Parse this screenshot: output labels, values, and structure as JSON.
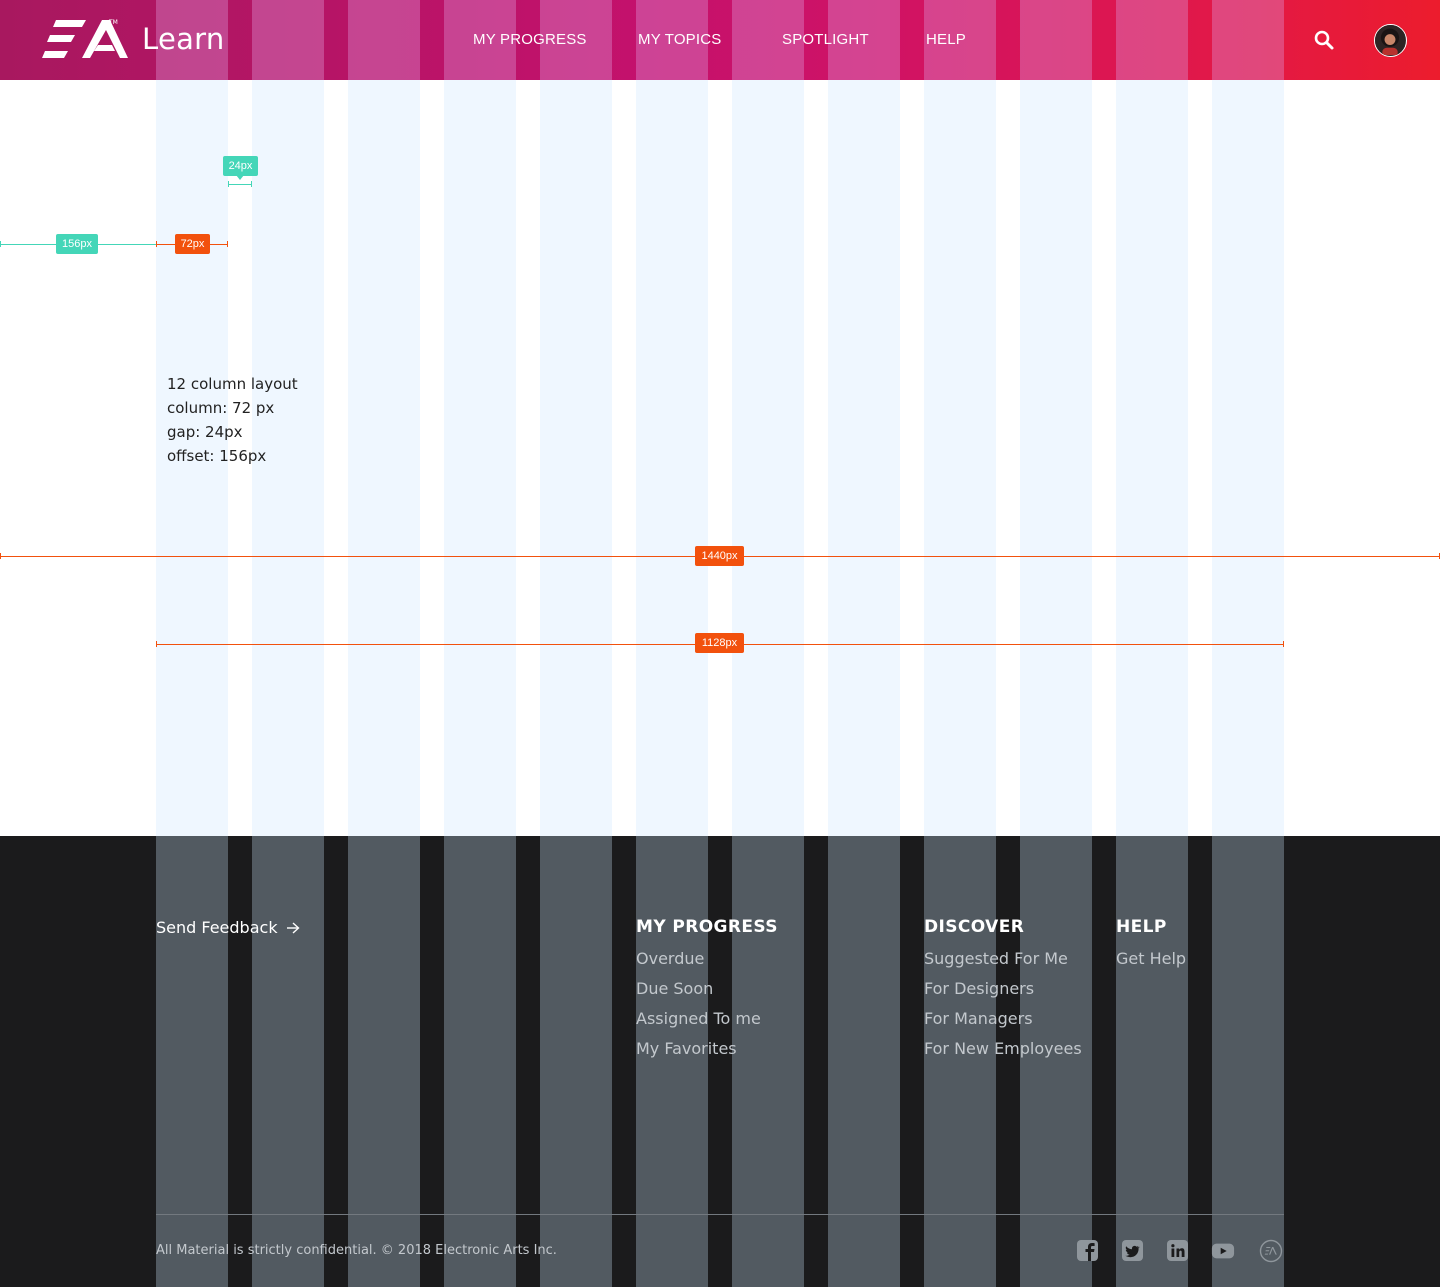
{
  "header": {
    "brand": "Learn",
    "logo_name": "EA",
    "nav": [
      "MY PROGRESS",
      "MY TOPICS",
      "SPOTLIGHT",
      "HELP"
    ]
  },
  "annotations": {
    "gap_label": "24px",
    "offset_label": "156px",
    "column_label": "72px",
    "page_width_label": "1440px",
    "content_width_label": "1128px"
  },
  "spec": {
    "lines": [
      "12 column layout",
      "column: 72 px",
      "gap: 24px",
      "offset: 156px"
    ]
  },
  "footer": {
    "feedback": "Send Feedback",
    "columns": [
      {
        "heading": "MY PROGRESS",
        "links": [
          "Overdue",
          "Due Soon",
          "Assigned To me",
          "My Favorites"
        ]
      },
      {
        "heading": "DISCOVER",
        "links": [
          "Suggested For Me",
          "For Designers",
          "For Managers",
          "For New Employees"
        ]
      },
      {
        "heading": "HELP",
        "links": [
          "Get Help"
        ]
      }
    ],
    "copyright": "All Material is strictly confidential. © 2018 Electronic Arts Inc.",
    "social": [
      "facebook-icon",
      "twitter-icon",
      "linkedin-icon",
      "youtube-icon",
      "ea-icon"
    ]
  },
  "colors": {
    "header_start": "#a8185f",
    "header_end": "#ec1c2d",
    "column_light": "#eff7ff",
    "footer_bg": "#1b1b1c",
    "footer_column": "#525a61",
    "measure_teal": "#44d6b8",
    "measure_orange": "#f2510d"
  }
}
